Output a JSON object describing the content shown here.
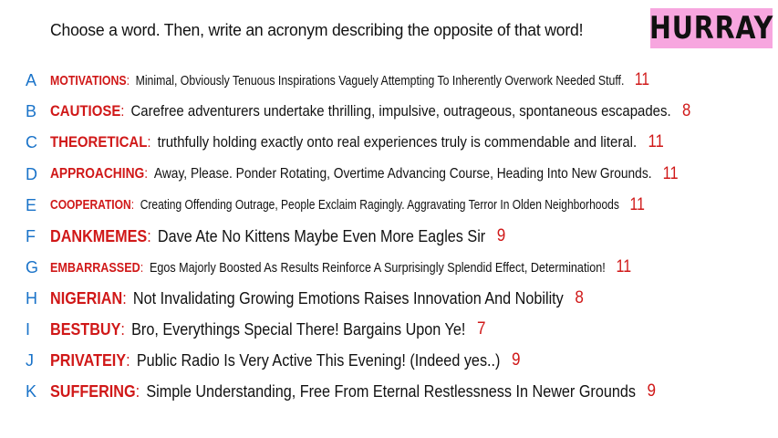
{
  "prompt": "Choose a word. Then, write an acronym describing the opposite of that word!",
  "badge": "HURRAY",
  "colors": {
    "letter": "#1a73c9",
    "word": "#d01818",
    "text": "#111111",
    "badge_bg": "#f7a6df"
  },
  "items": [
    {
      "letter": "A",
      "word": "MOTIVATIONS",
      "text": "Minimal, Obviously Tenuous Inspirations Vaguely Attempting To Inherently Overwork Needed Stuff.",
      "count": "11"
    },
    {
      "letter": "B",
      "word": "CAUTIOSE",
      "text": "Carefree adventurers undertake thrilling, impulsive, outrageous, spontaneous escapades.",
      "count": "8"
    },
    {
      "letter": "C",
      "word": "THEORETICAL",
      "text": "truthfully holding exactly onto real experiences truly is commendable and literal.",
      "count": "11"
    },
    {
      "letter": "D",
      "word": "APPROACHING",
      "text": "Away, Please. Ponder Rotating, Overtime Advancing Course, Heading Into New Grounds.",
      "count": "11"
    },
    {
      "letter": "E",
      "word": "COOPERATION",
      "text": "Creating Offending Outrage, People Exclaim Ragingly. Aggravating Terror In Olden Neighborhoods",
      "count": "11"
    },
    {
      "letter": "F",
      "word": "DANKMEMES",
      "text": "Dave Ate No Kittens Maybe Even More Eagles Sir",
      "count": "9"
    },
    {
      "letter": "G",
      "word": "EMBARRASSED",
      "text": "Egos Majorly Boosted As Results Reinforce A Surprisingly Splendid Effect, Determination!",
      "count": "11"
    },
    {
      "letter": "H",
      "word": "NIGERIAN",
      "text": "Not Invalidating Growing Emotions Raises Innovation And Nobility",
      "count": "8"
    },
    {
      "letter": "I",
      "word": "BESTBUY",
      "text": "Bro, Everythings Special There! Bargains Upon Ye!",
      "count": "7"
    },
    {
      "letter": "J",
      "word": "PRIVATEIY",
      "text": "Public Radio Is Very Active This Evening! (Indeed yes..)",
      "count": "9"
    },
    {
      "letter": "K",
      "word": "SUFFERING",
      "text": "Simple Understanding, Free From Eternal Restlessness In Newer Grounds",
      "count": "9"
    }
  ]
}
